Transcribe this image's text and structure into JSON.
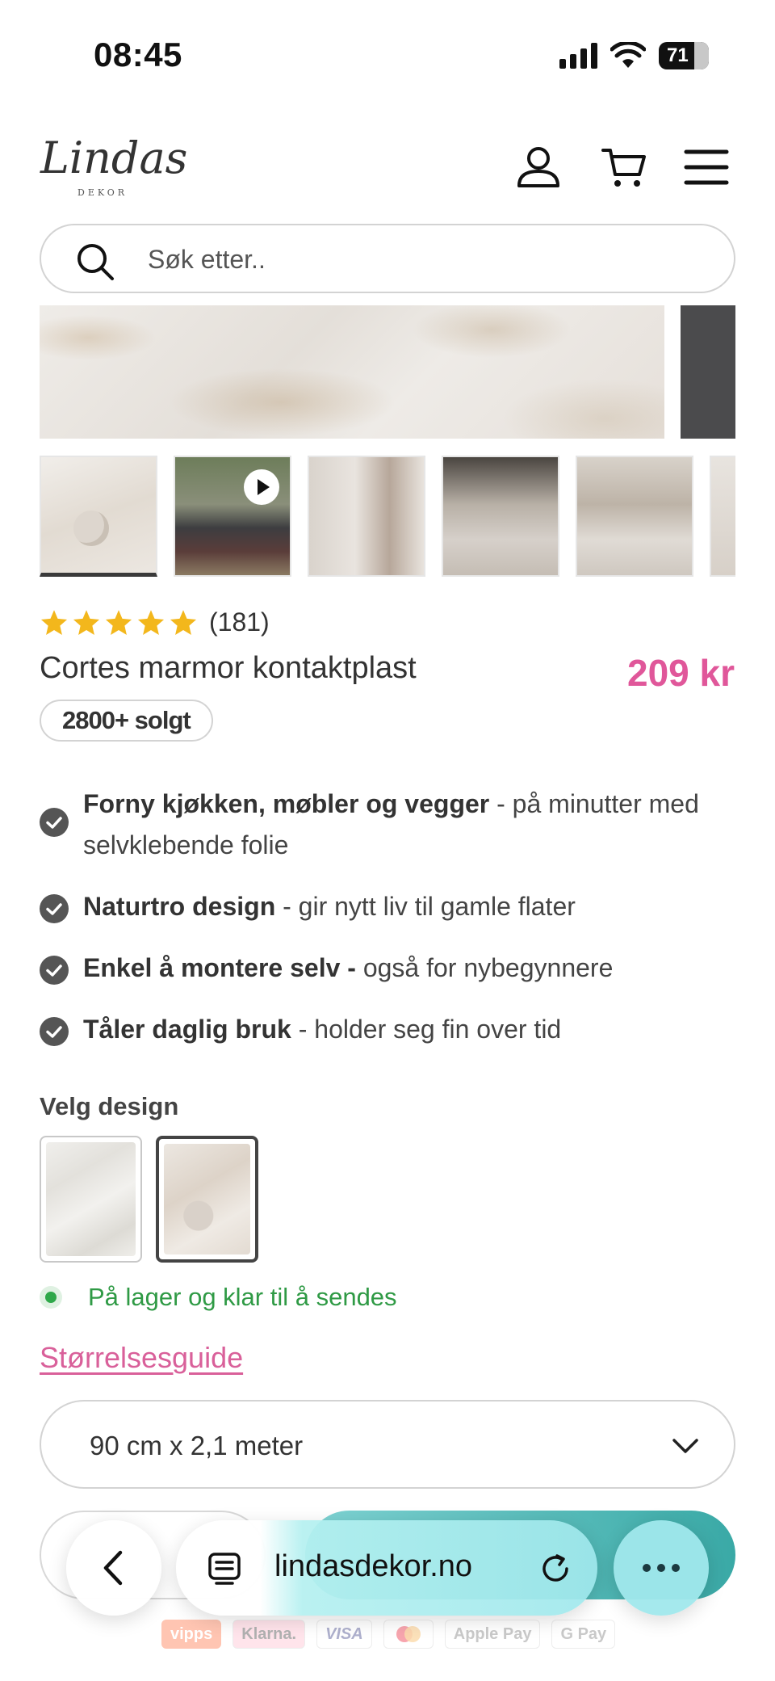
{
  "status_bar": {
    "time": "08:45",
    "battery": "71"
  },
  "header": {
    "logo_text": "Lindas",
    "logo_sub": "DEKOR"
  },
  "search": {
    "placeholder": "Søk etter.."
  },
  "gallery": {
    "thumbnail_count": 6,
    "active_index": 0
  },
  "product": {
    "rating_count": "(181)",
    "stars": 5,
    "title": "Cortes marmor kontaktplast",
    "price": "209 kr",
    "sold_badge": "2800+ solgt"
  },
  "benefits": [
    {
      "bold": "Forny kjøkken, møbler og vegger",
      "rest": " - på minutter med selvklebende folie"
    },
    {
      "bold": "Naturtro design",
      "rest": " - gir nytt liv til gamle flater"
    },
    {
      "bold": "Enkel å montere selv -",
      "rest": " også for nybegynnere"
    },
    {
      "bold": "Tåler daglig bruk",
      "rest": " - holder seg fin over tid"
    }
  ],
  "design": {
    "label": "Velg design",
    "selected_index": 1
  },
  "stock": {
    "text": "På lager og klar til å sendes"
  },
  "size_guide": {
    "label": "Størrelsesguide"
  },
  "size_select": {
    "value": "90 cm x 2,1 meter"
  },
  "payments": [
    "vipps",
    "Klarna.",
    "VISA",
    "Mastercard",
    "Apple Pay",
    "G Pay"
  ],
  "browser": {
    "url": "lindasdekor.no"
  },
  "colors": {
    "accent_pink": "#e0579a",
    "stock_green": "#2f9a45",
    "teal": "#3aa9a6"
  }
}
